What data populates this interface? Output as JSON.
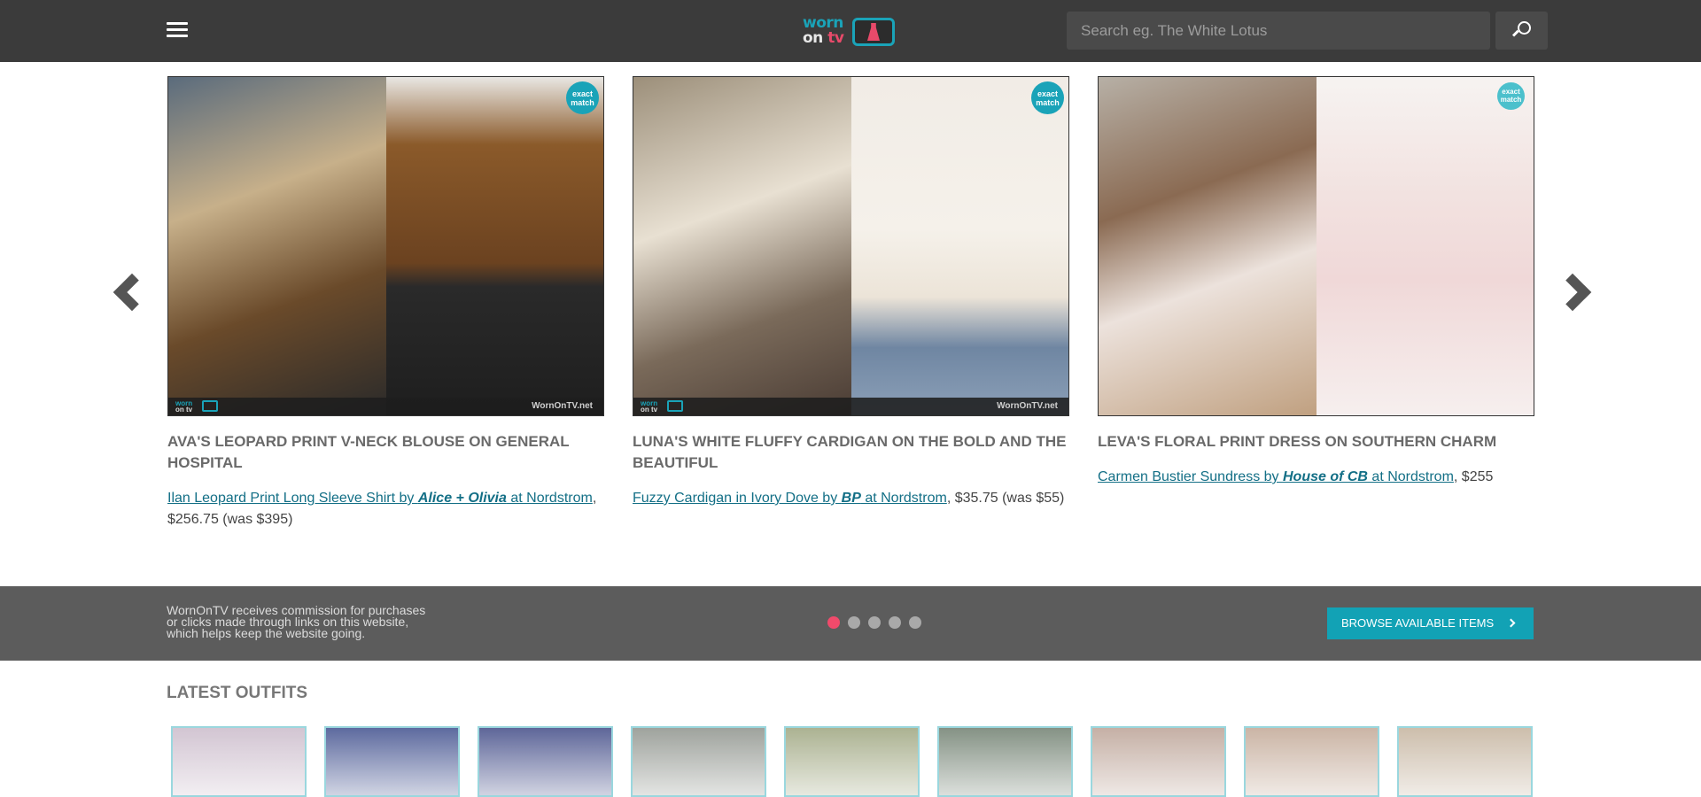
{
  "header": {
    "menu_icon": "hamburger-menu-icon",
    "logo": {
      "line1": "worn",
      "line2_a": "on ",
      "line2_b": "tv"
    },
    "search": {
      "placeholder": "Search eg. The White Lotus",
      "value": "",
      "icon": "search-icon"
    }
  },
  "carousel": {
    "cards": [
      {
        "badge": {
          "line1": "exact",
          "line2": "match"
        },
        "watermark": "WornOnTV.net",
        "title": "Ava's Leopard Print V-Neck Blouse on General Hospital",
        "link_prefix": "Ilan Leopard Print Long Sleeve Shirt by ",
        "brand": "Alice + Olivia",
        "link_suffix": " at Nordstrom",
        "price": ", $256.75 (was $395)",
        "colors": {
          "left": "#4a4038",
          "right": "#6b4a2a"
        }
      },
      {
        "badge": {
          "line1": "exact",
          "line2": "match"
        },
        "watermark": "WornOnTV.net",
        "title": "Luna's White Fluffy Cardigan on The Bold and the Beautiful",
        "link_prefix": "Fuzzy Cardigan in Ivory Dove by ",
        "brand": "BP",
        "link_suffix": " at Nordstrom",
        "price": ", $35.75 (was $55)",
        "colors": {
          "left": "#8a7c6c",
          "right": "#efe9e2"
        }
      },
      {
        "badge": {
          "line1": "exact",
          "line2": "match"
        },
        "title": "Leva's Floral Print Dress on Southern Charm",
        "link_prefix": "Carmen Bustier Sundress by ",
        "brand": "House of CB",
        "link_suffix": " at Nordstrom",
        "price": ", $255",
        "colors": {
          "left": "#9b8a7a",
          "right": "#f3ecea"
        }
      }
    ],
    "prev_icon": "chevron-left-icon",
    "next_icon": "chevron-right-icon"
  },
  "bar": {
    "disclaimer": "WornOnTV receives commission for purchases or clicks made through links on this website, which helps keep the website going.",
    "browse_label": "Browse Available Items",
    "dots": [
      true,
      false,
      false,
      false,
      false
    ]
  },
  "latest": {
    "title": "Latest Outfits",
    "thumb_colors": [
      "#c9b9c9",
      "#3a4a8a",
      "#3b4583",
      "#8a8f88",
      "#9aa27a",
      "#6a7a6a",
      "#b99f92",
      "#c0a592",
      "#c2b09a"
    ]
  },
  "colors": {
    "accent": "#12a2b5",
    "header_bg": "#3b3b3b",
    "bar_bg": "#5c5c5c",
    "active_dot": "#f04a6b",
    "link": "#136f86"
  }
}
